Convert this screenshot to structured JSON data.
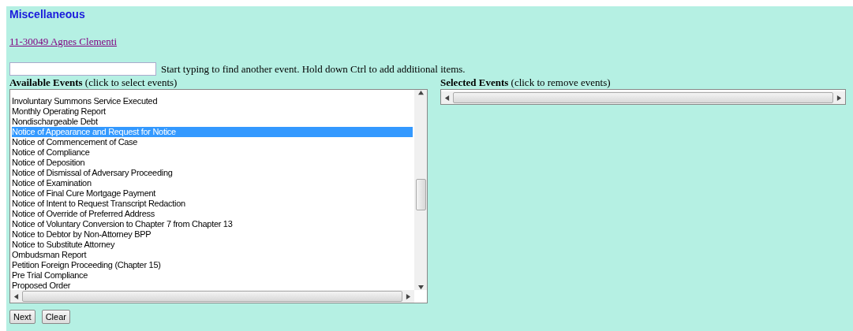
{
  "page_title": "Miscellaneous",
  "case_link": "11-30049 Agnes Clementi",
  "search": {
    "hint": "Start typing to find another event. Hold down Ctrl to add additional items."
  },
  "available": {
    "heading": "Available Events",
    "note": "(click to select events)",
    "items": [
      {
        "label": "Involuntary Summons Service Executed",
        "selected": false
      },
      {
        "label": "Monthly Operating Report",
        "selected": false
      },
      {
        "label": "Nondischargeable Debt",
        "selected": false
      },
      {
        "label": "Notice of Appearance and Request for Notice",
        "selected": true
      },
      {
        "label": "Notice of Commencement of Case",
        "selected": false
      },
      {
        "label": "Notice of Compliance",
        "selected": false
      },
      {
        "label": "Notice of Deposition",
        "selected": false
      },
      {
        "label": "Notice of Dismissal of Adversary Proceeding",
        "selected": false
      },
      {
        "label": "Notice of Examination",
        "selected": false
      },
      {
        "label": "Notice of Final Cure Mortgage Payment",
        "selected": false
      },
      {
        "label": "Notice of Intent to Request Transcript Redaction",
        "selected": false
      },
      {
        "label": "Notice of Override of Preferred Address",
        "selected": false
      },
      {
        "label": "Notice of Voluntary Conversion to Chapter 7 from Chapter 13",
        "selected": false
      },
      {
        "label": "Notice to Debtor by Non-Attorney BPP",
        "selected": false
      },
      {
        "label": "Notice to Substitute Attorney",
        "selected": false
      },
      {
        "label": "Ombudsman Report",
        "selected": false
      },
      {
        "label": "Petition Foreign Proceeding (Chapter 15)",
        "selected": false
      },
      {
        "label": "Pre Trial Compliance",
        "selected": false
      },
      {
        "label": "Proposed Order",
        "selected": false
      }
    ]
  },
  "selected_events": {
    "heading": "Selected Events",
    "note": "(click to remove events)"
  },
  "buttons": [
    "Next",
    "Clear"
  ]
}
